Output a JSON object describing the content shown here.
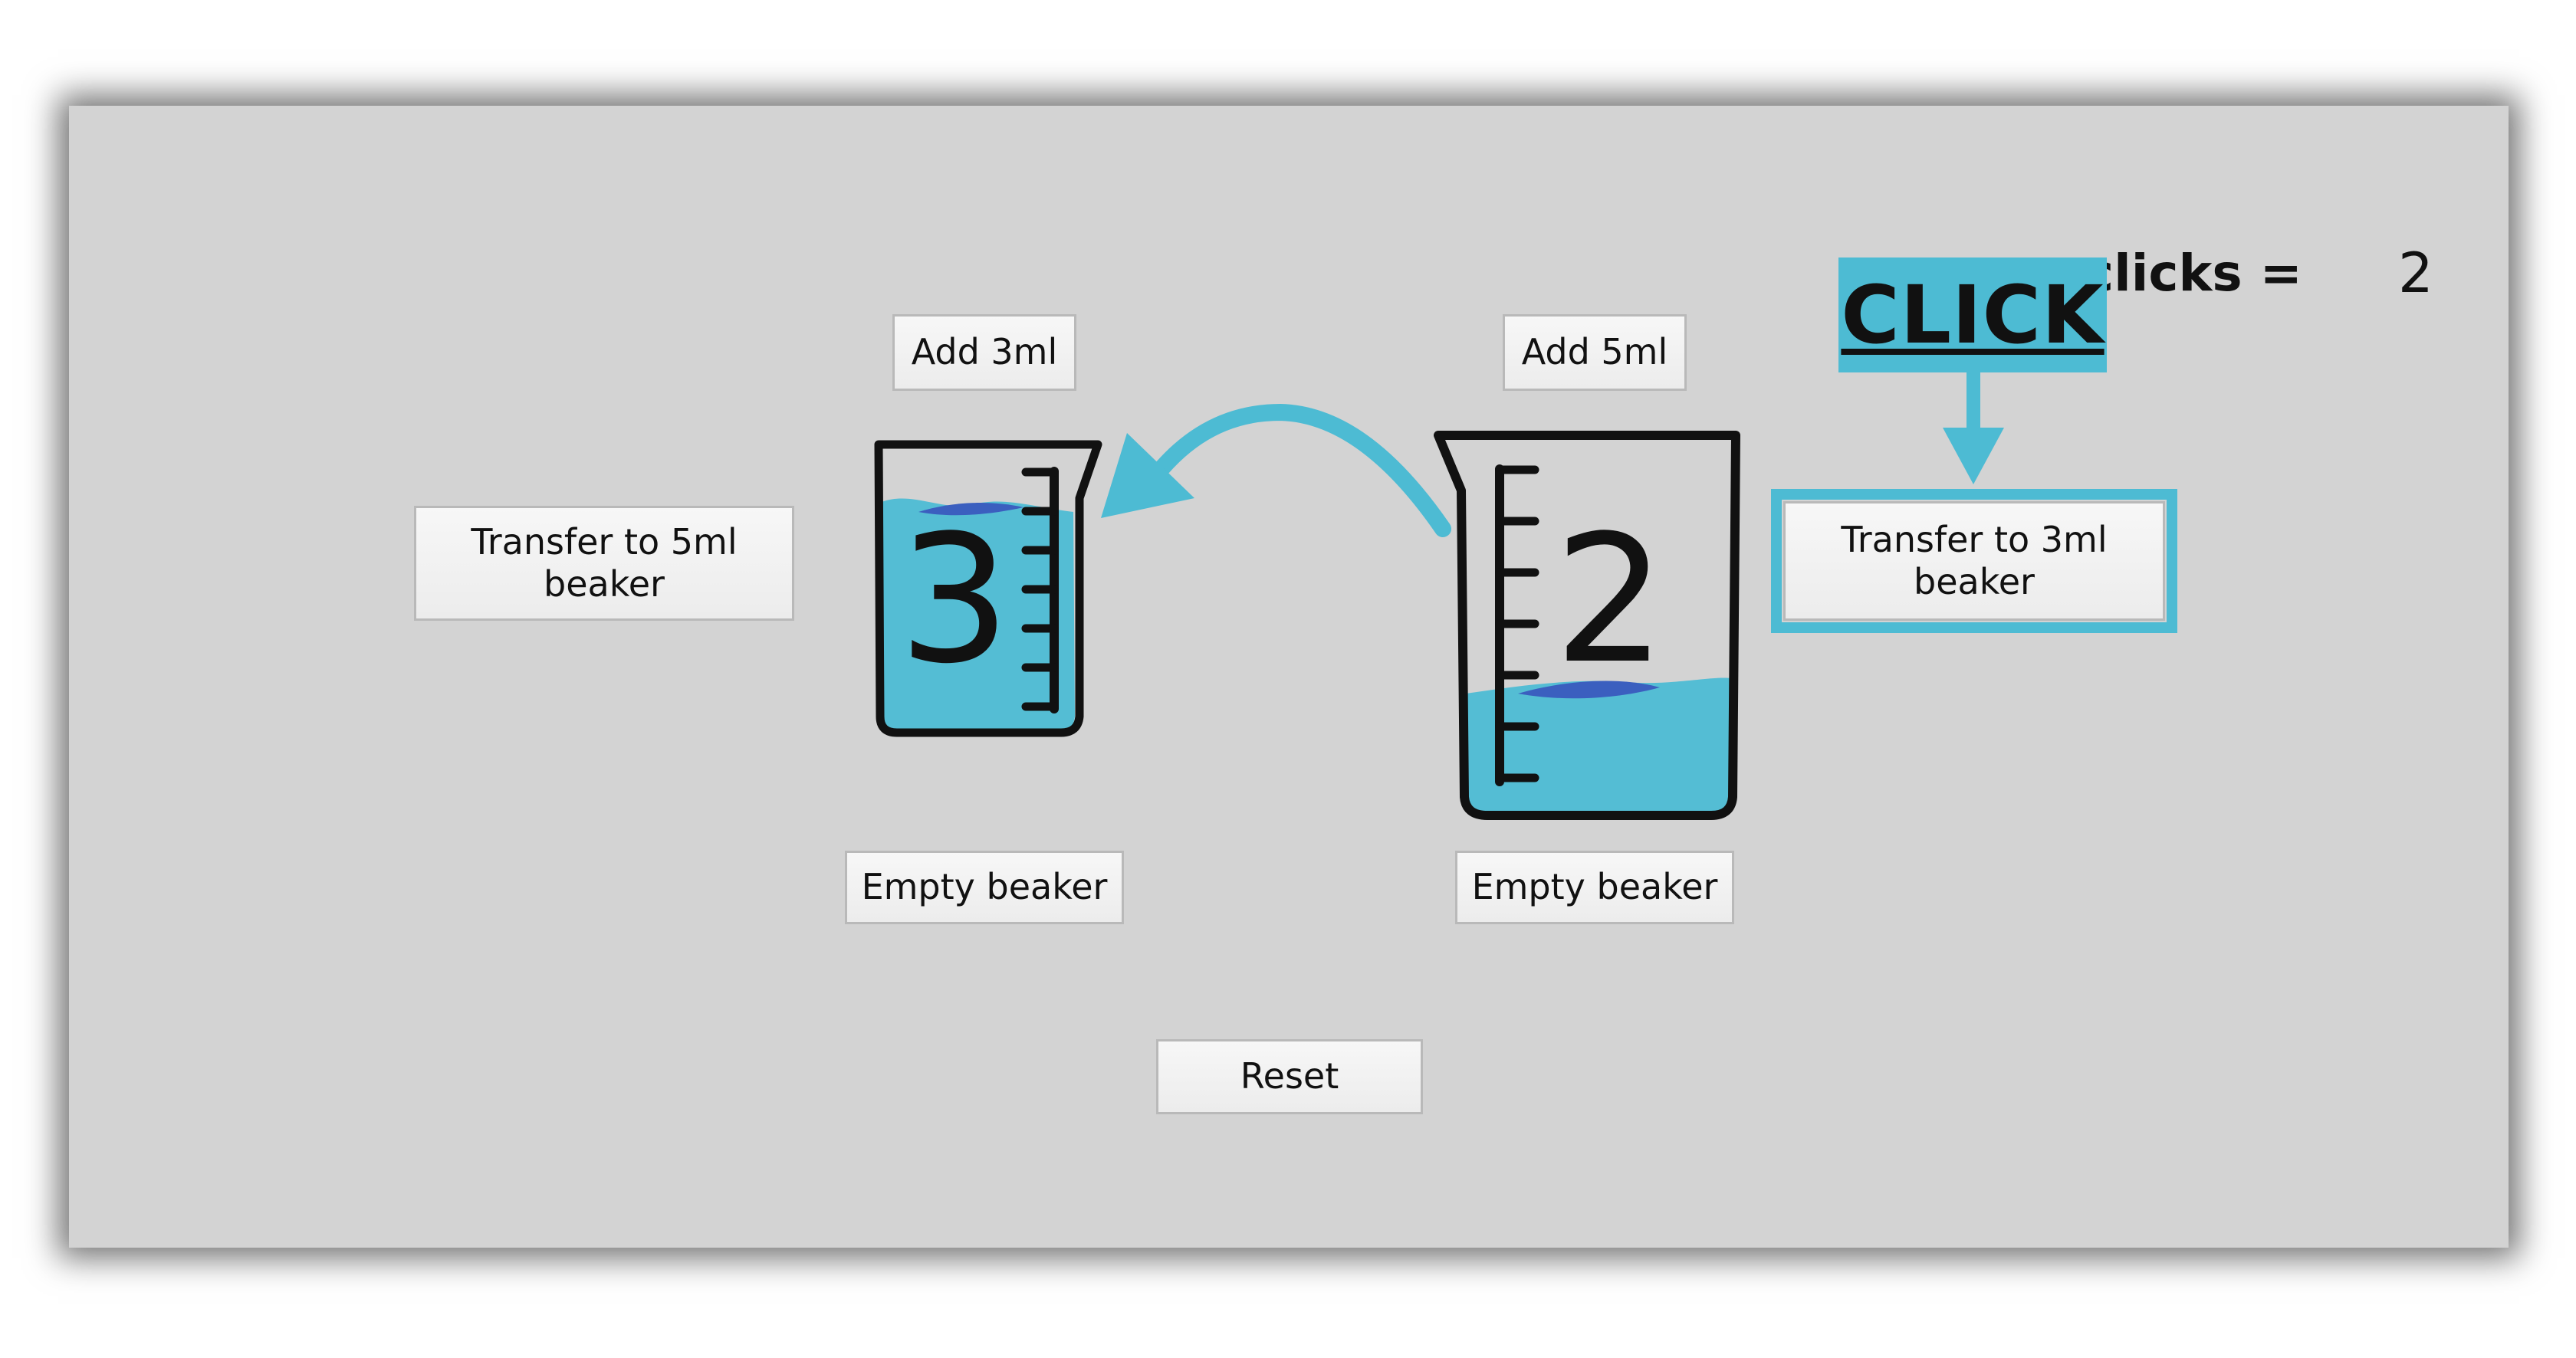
{
  "counter": {
    "label": "clicks =",
    "value": "2"
  },
  "callout": {
    "text": "CLICK",
    "color": "#4dbbd3"
  },
  "beaker_small": {
    "level": "3",
    "add_label": "Add 3ml",
    "empty_label": "Empty beaker",
    "transfer_label": "Transfer to 5ml beaker",
    "water_color": "#54bdd4"
  },
  "beaker_large": {
    "level": "2",
    "add_label": "Add 5ml",
    "empty_label": "Empty beaker",
    "transfer_label": "Transfer to 3ml beaker",
    "water_color": "#54bdd4"
  },
  "reset_label": "Reset",
  "colors": {
    "panel": "#d3d3d3",
    "accent": "#4dbbd3",
    "wave": "#3b5fbf"
  },
  "icons": {
    "transfer_arrow": "curved-arrow-left-icon",
    "callout_arrow": "arrow-down-icon"
  }
}
